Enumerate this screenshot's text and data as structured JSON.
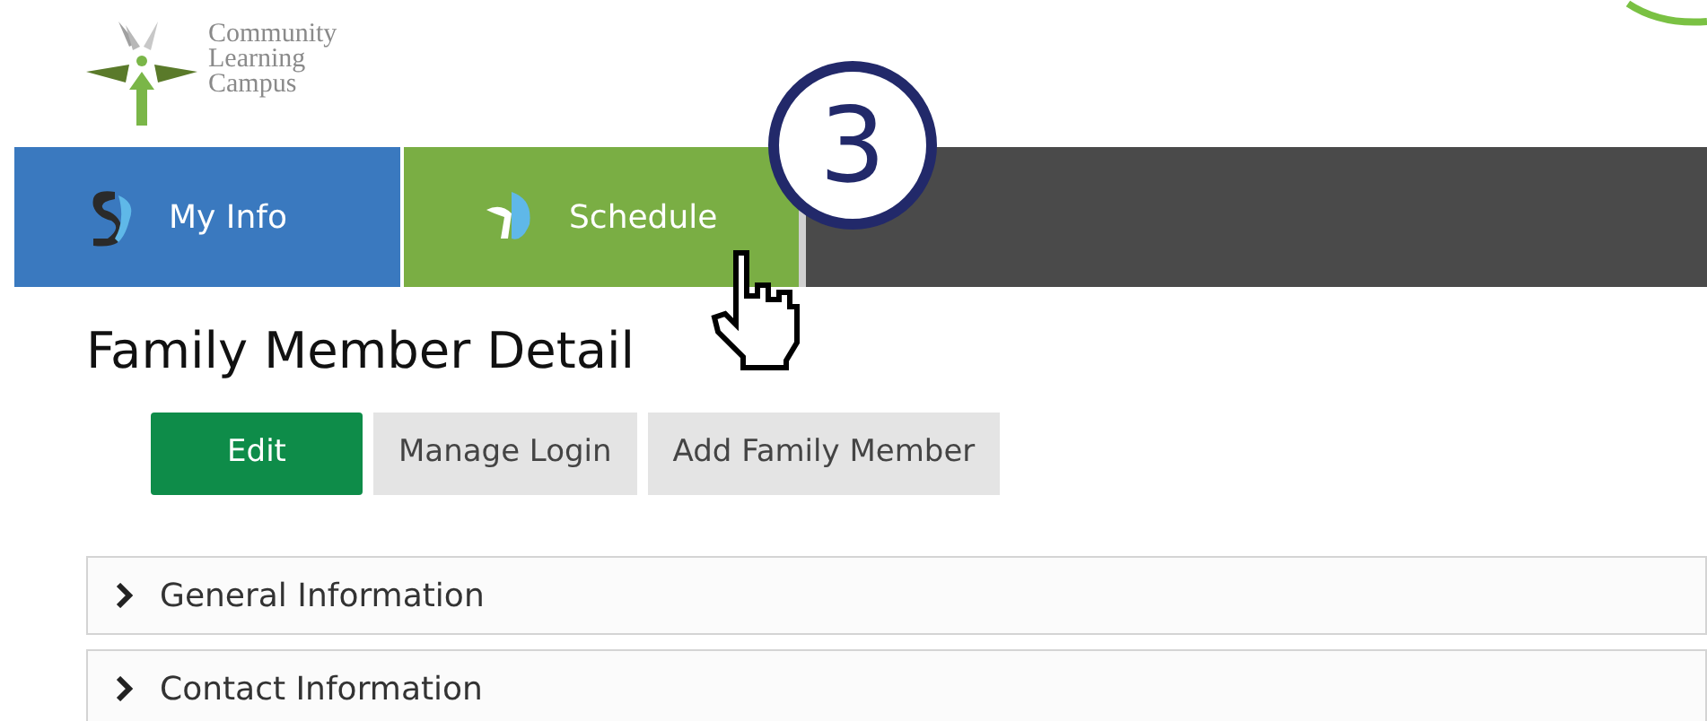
{
  "logo": {
    "lines": [
      "Community",
      "Learning",
      "Campus"
    ]
  },
  "tabs": [
    {
      "label": "My Info",
      "color": "#3a79bf"
    },
    {
      "label": "Schedule",
      "color": "#7aae44"
    }
  ],
  "callout": {
    "label": "3"
  },
  "heading": "Family Member Detail",
  "buttons": [
    {
      "label": "Edit",
      "kind": "primary"
    },
    {
      "label": "Manage Login",
      "kind": "secondary"
    },
    {
      "label": "Add Family Member",
      "kind": "secondary"
    }
  ],
  "sections": [
    {
      "title": "General Information",
      "expanded": false
    },
    {
      "title": "Contact Information",
      "expanded": false
    }
  ]
}
